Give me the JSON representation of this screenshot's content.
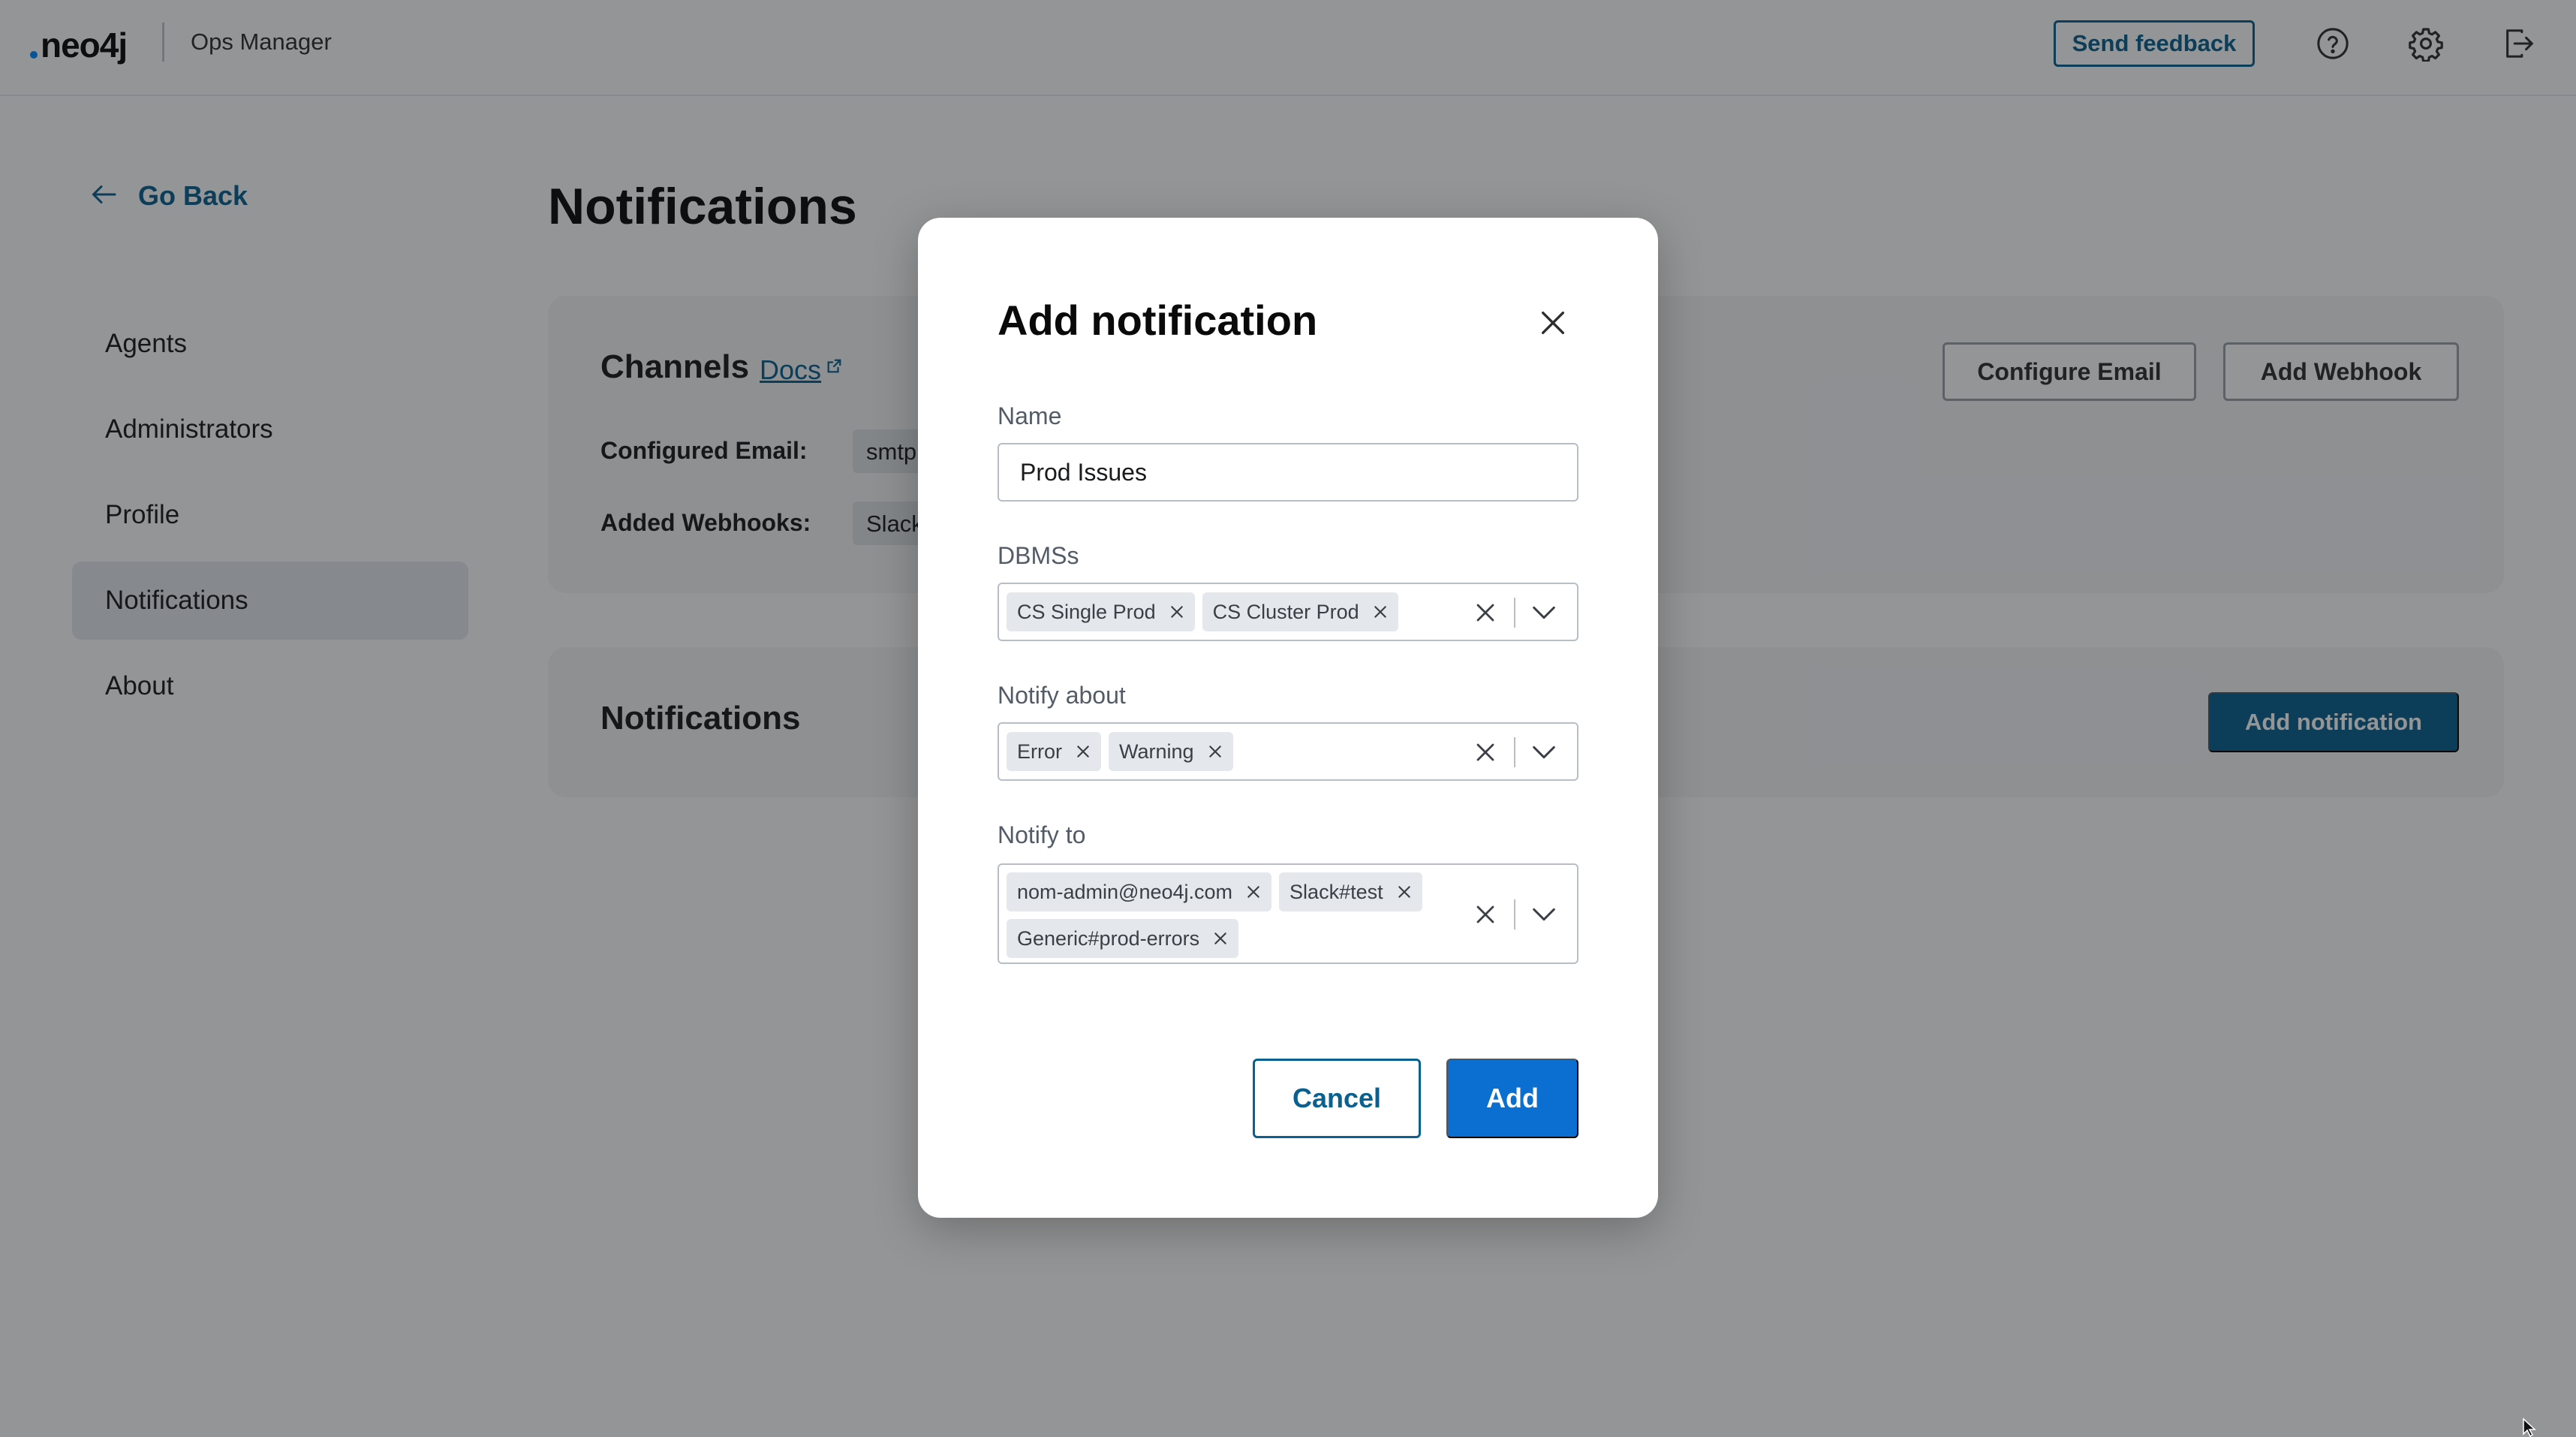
{
  "app": {
    "logo_text": "neo4j",
    "name": "Ops Manager",
    "send_feedback_label": "Send feedback",
    "icons": [
      "help-circle-icon",
      "gear-icon",
      "logout-icon"
    ]
  },
  "sidebar": {
    "go_back_label": "Go Back",
    "items": [
      {
        "label": "Agents",
        "active": false
      },
      {
        "label": "Administrators",
        "active": false
      },
      {
        "label": "Profile",
        "active": false
      },
      {
        "label": "Notifications",
        "active": true
      },
      {
        "label": "About",
        "active": false
      }
    ]
  },
  "main": {
    "title": "Notifications",
    "channels": {
      "title": "Channels",
      "docs_label": "Docs",
      "configured_email_label": "Configured Email:",
      "configured_email_value": "smtp",
      "added_webhooks_label": "Added Webhooks:",
      "added_webhooks_value": "Slack",
      "configure_email_label": "Configure Email",
      "add_webhook_label": "Add Webhook"
    },
    "notifications": {
      "title": "Notifications",
      "add_notification_label": "Add notification"
    }
  },
  "modal": {
    "title": "Add notification",
    "name_label": "Name",
    "name_value": "Prod Issues",
    "dbms_label": "DBMSs",
    "dbms_tags": [
      "CS Single Prod",
      "CS Cluster Prod"
    ],
    "notify_about_label": "Notify about",
    "notify_about_tags": [
      "Error",
      "Warning"
    ],
    "notify_to_label": "Notify to",
    "notify_to_tags": [
      "nom-admin@neo4j.com",
      "Slack#test",
      "Generic#prod-errors"
    ],
    "cancel_label": "Cancel",
    "add_label": "Add"
  },
  "colors": {
    "brand": "#0a6190",
    "primary_button": "#0a6fd0",
    "active_nav": "#e6e9ee",
    "card_bg": "#f5f6f8",
    "tag_bg": "#e4e7eb"
  }
}
